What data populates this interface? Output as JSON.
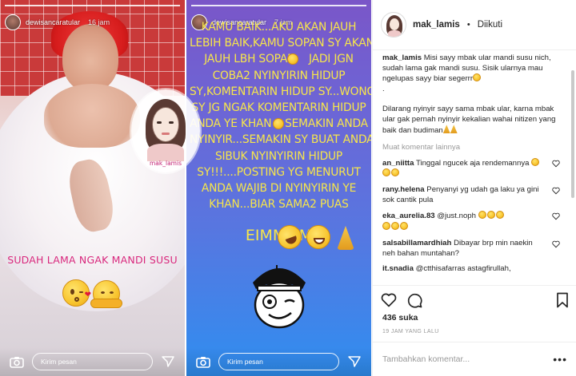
{
  "story1": {
    "username": "dewisancaratular",
    "time": "16 jam",
    "caption": "SUDAH LAMA NGAK MANDI SUSU",
    "message_placeholder": "Kirim pesan"
  },
  "story2": {
    "username": "dewisancaratular",
    "time": "7 jam",
    "lines": [
      "KAMU BAIK...AKU AKAN JAUH",
      "LEBIH BAIK,KAMU SOPAN SY AKAN",
      "JAUH LBH SOPAN    JADI JGN",
      "COBA2 NYINYIRIN HIDUP",
      "SY,KOMENTARIN HIDUP SY...WONG",
      "SY JG NGAK KOMENTARIN HIDUP",
      "ANDA YE KHAN    SEMAKIN ANDA",
      "NYINYIR...SEMAKIN SY BUAT ANDA",
      "SIBUK NYINYIRIN HIDUP",
      "SY!!!....POSTING YG MENURUT",
      "ANDA WAJIB DI NYINYIRIN YE",
      "KHAN...BIAR SAMA2 PUAS"
    ],
    "big_line": "EIMMMM",
    "message_placeholder": "Kirim pesan"
  },
  "logo": {
    "text": "mak_lamis"
  },
  "post": {
    "username": "mak_lamis",
    "follow_status": "Diikuti",
    "caption": {
      "user": "mak_lamis",
      "paragraph1": "Misi sayy mbak ular mandi susu nich, sudah lama gak mandi susu. Sisik ularnya mau ngelupas sayy biar segerrr",
      "paragraph1b": ".",
      "paragraph2": "Dilarang nyinyir sayy sama mbak ular, karna mbak ular gak pernah nyinyir kekalian wahai nitizen yang baik dan budiman"
    },
    "more_comments": "Muat komentar lainnya",
    "comments": [
      {
        "user": "an_niitta",
        "text": "Tinggal ngucek aja rendemannya"
      },
      {
        "user": "rany.helena",
        "text": "Penyanyi yg udah ga laku ya gini sok cantik pula"
      },
      {
        "user": "eka_aurelia.83",
        "text": "@just.noph"
      },
      {
        "user": "salsabillamardhiah",
        "text": "Dibayar brp min naekin neh bahan muntahan?"
      },
      {
        "user": "it.snadia",
        "text": "@ctthisafarras astagfirullah,"
      }
    ],
    "likes": "436 suka",
    "time_ago": "19 JAM YANG LALU",
    "add_comment_placeholder": "Tambahkan komentar...",
    "more_icon_label": "•••"
  },
  "colors": {
    "story2_text": "#f7e64a",
    "story1_caption": "#d6247a",
    "muted": "#999999"
  }
}
